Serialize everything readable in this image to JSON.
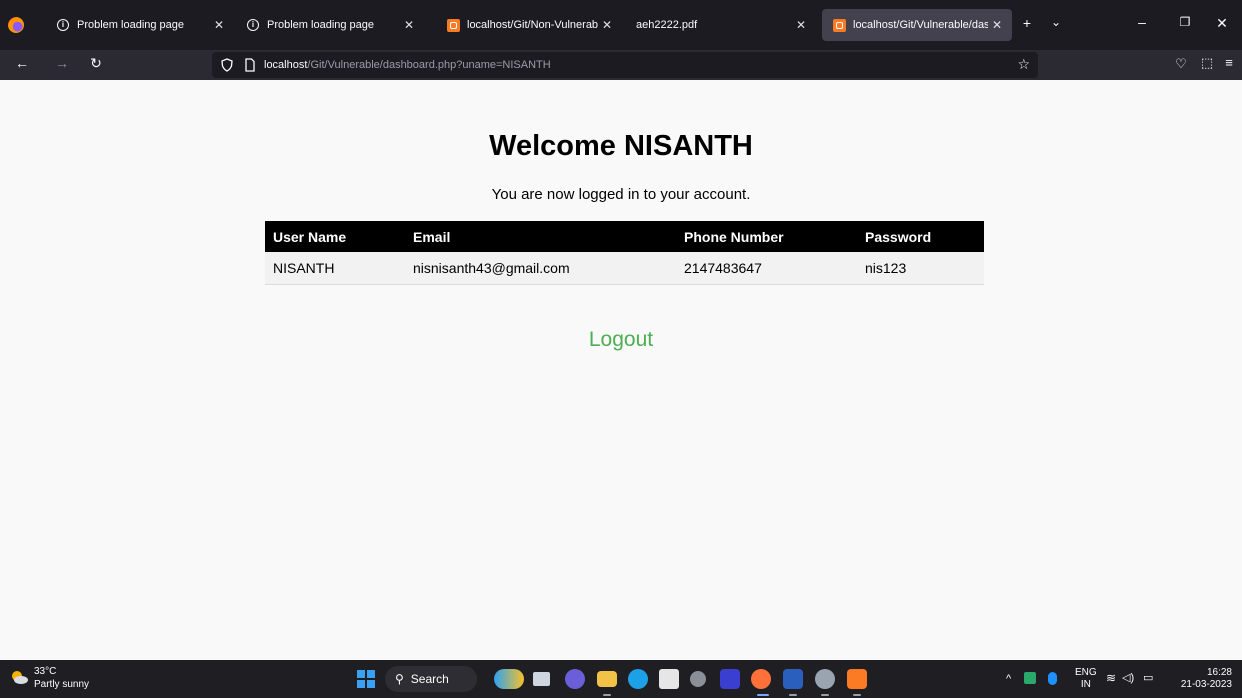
{
  "browser": {
    "tabs": [
      {
        "title": "Problem loading page",
        "icon": "info-icon",
        "active": false
      },
      {
        "title": "Problem loading page",
        "icon": "info-icon",
        "active": false
      },
      {
        "title": "localhost/Git/Non-Vulnerable/d",
        "icon": "xampp-icon",
        "active": false
      },
      {
        "title": "aeh2222.pdf",
        "icon": "pdf-icon",
        "active": false
      },
      {
        "title": "localhost/Git/Vulnerable/dashb",
        "icon": "xampp-icon",
        "active": true
      }
    ],
    "url_host": "localhost",
    "url_path": "/Git/Vulnerable/dashboard.php?uname=NISANTH"
  },
  "page": {
    "heading": "Welcome NISANTH",
    "subtitle": "You are now logged in to your account.",
    "table": {
      "headers": [
        "User Name",
        "Email",
        "Phone Number",
        "Password"
      ],
      "rows": [
        [
          "NISANTH",
          "nisnisanth43@gmail.com",
          "2147483647",
          "nis123"
        ]
      ]
    },
    "logout_label": "Logout",
    "colors": {
      "logout": "#4caf50",
      "header_bg": "#000000"
    }
  },
  "taskbar": {
    "weather_temp": "33°C",
    "weather_desc": "Partly sunny",
    "search_label": "Search",
    "lang_top": "ENG",
    "lang_bottom": "IN",
    "time": "16:28",
    "date": "21-03-2023"
  }
}
